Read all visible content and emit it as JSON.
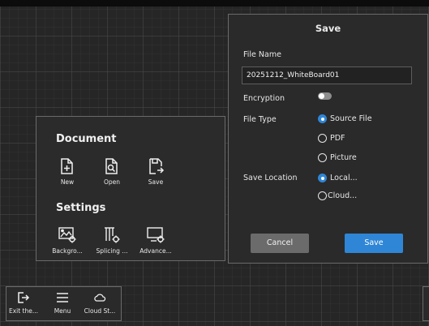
{
  "menu_panel": {
    "document_title": "Document",
    "document_items": [
      {
        "label": "New",
        "icon": "new-file-icon"
      },
      {
        "label": "Open",
        "icon": "open-file-icon"
      },
      {
        "label": "Save",
        "icon": "save-file-icon"
      }
    ],
    "settings_title": "Settings",
    "settings_items": [
      {
        "label": "Backgro...",
        "icon": "background-settings-icon"
      },
      {
        "label": "Splicing ...",
        "icon": "splicing-settings-icon"
      },
      {
        "label": "Advance...",
        "icon": "advanced-settings-icon"
      }
    ]
  },
  "save_dialog": {
    "title": "Save",
    "file_name_label": "File Name",
    "file_name_value": "20251212_WhiteBoard01",
    "encryption_label": "Encryption",
    "encryption_on": false,
    "file_type_label": "File Type",
    "file_type_options": [
      "Source File",
      "PDF",
      "Picture"
    ],
    "file_type_selected": "Source File",
    "save_location_label": "Save Location",
    "save_location_options": [
      "Local...",
      "Cloud..."
    ],
    "save_location_selected": "Local...",
    "cancel_label": "Cancel",
    "save_label": "Save",
    "accent_color": "#2f86d6"
  },
  "bottom_bar": {
    "items": [
      {
        "label": "Exit the...",
        "icon": "exit-icon"
      },
      {
        "label": "Menu",
        "icon": "menu-icon"
      },
      {
        "label": "Cloud St...",
        "icon": "cloud-icon"
      }
    ]
  }
}
